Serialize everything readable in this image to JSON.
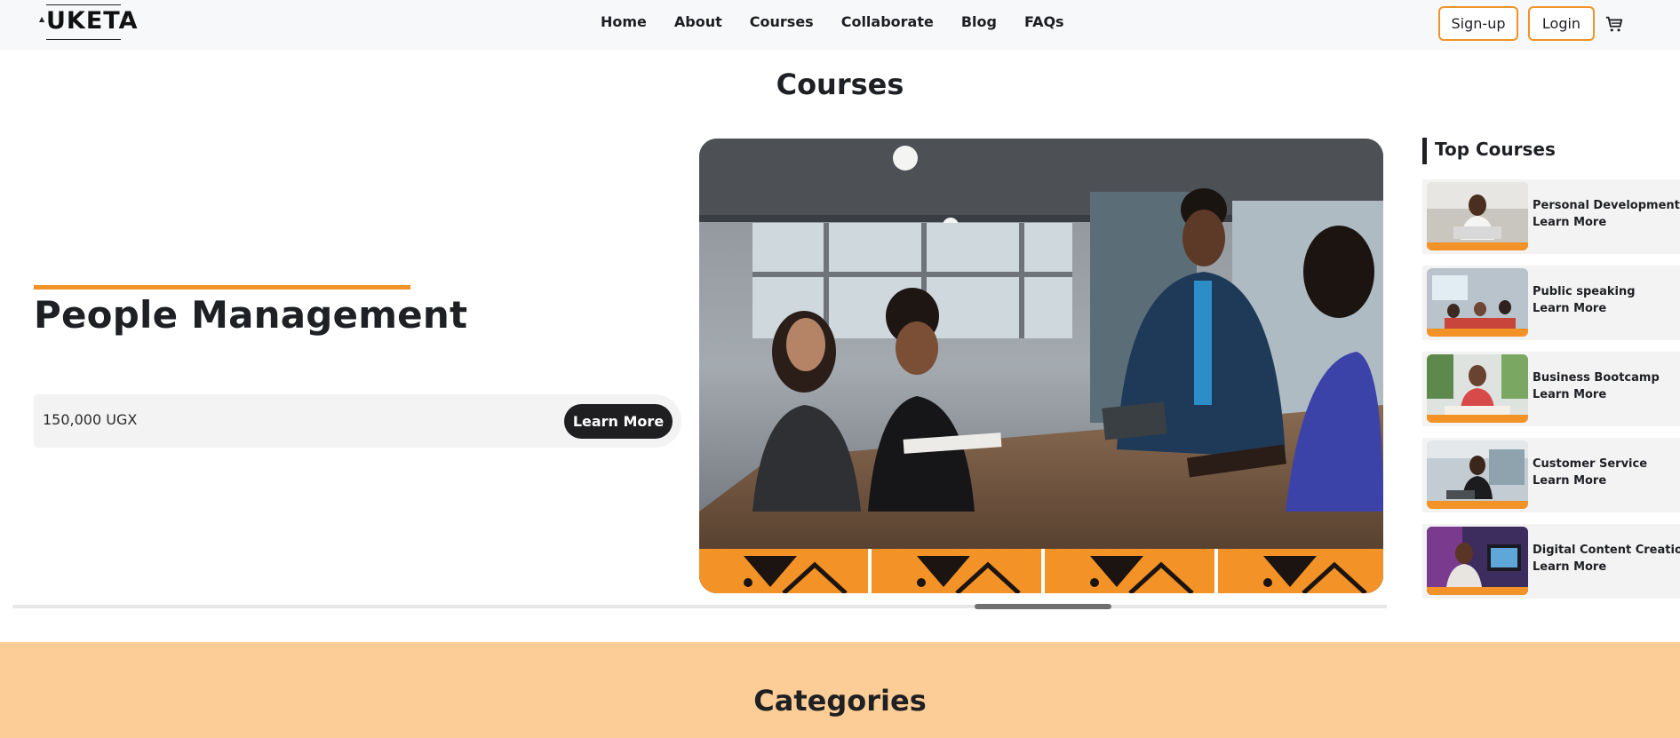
{
  "header": {
    "logo_text": "UKETA",
    "nav": [
      "Home",
      "About",
      "Courses",
      "Collaborate",
      "Blog",
      "FAQs"
    ],
    "signup_label": "Sign-up",
    "login_label": "Login",
    "cart_icon": "cart-icon"
  },
  "courses": {
    "title": "Courses",
    "featured": {
      "name": "People Management",
      "price": "150,000 UGX",
      "cta": "Learn More"
    }
  },
  "top_courses": {
    "title": "Top Courses",
    "items": [
      {
        "name": "Personal Development",
        "link": "Learn More"
      },
      {
        "name": "Public speaking",
        "link": "Learn More"
      },
      {
        "name": "Business Bootcamp",
        "link": "Learn More"
      },
      {
        "name": "Customer Service",
        "link": "Learn More"
      },
      {
        "name": "Digital Content Creation",
        "link": "Learn More"
      }
    ]
  },
  "carousel": {
    "position": 0.75
  },
  "categories": {
    "title": "Categories"
  },
  "colors": {
    "accent": "#f29227",
    "dark": "#1f2024",
    "categories_bg": "#fdcd97",
    "header_bg": "#f7f8f9"
  }
}
